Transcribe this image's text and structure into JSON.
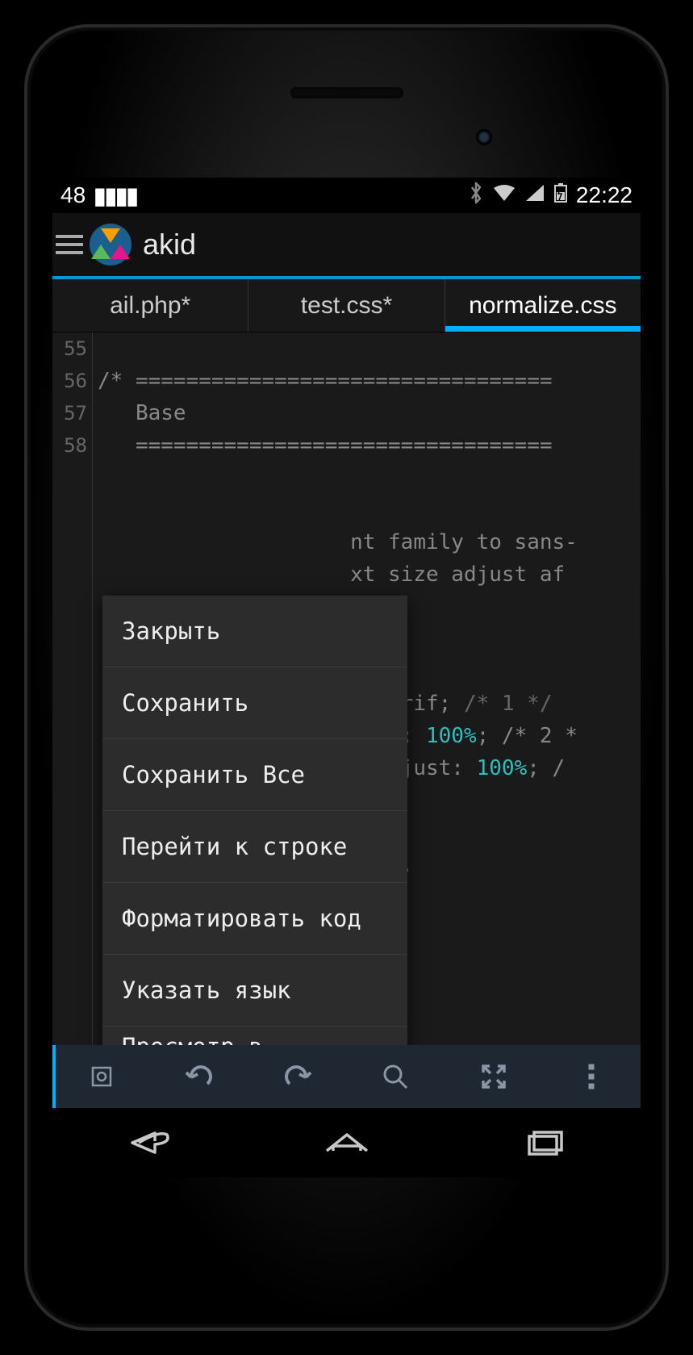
{
  "statusbar": {
    "notification_count": "48",
    "time": "22:22"
  },
  "actionbar": {
    "title": "akid"
  },
  "tabs": [
    {
      "label": "ail.php*",
      "active": false
    },
    {
      "label": "test.css*",
      "active": false
    },
    {
      "label": "normalize.css",
      "active": true
    }
  ],
  "editor": {
    "line_start": 55,
    "gutter_lines": [
      "55",
      "56",
      "57",
      "58"
    ],
    "code_lines": [
      "",
      "/* =================================",
      "   Base",
      "   =================================",
      "",
      "",
      "                    nt family to sans-",
      "                    xt size adjust af",
      "",
      "",
      "",
      "                    s-serif; /* 1 */",
      "                    just: 100%; /* 2 *",
      "                    e-adjust: 100%; /",
      "",
      "",
      "                    rgin.",
      ""
    ]
  },
  "popup": {
    "items": [
      "Закрыть",
      "Сохранить",
      "Сохранить Все",
      "Перейти к строке",
      "Форматировать код",
      "Указать язык",
      "Просмотр в браузере"
    ]
  },
  "toolbar_icons": [
    "settings",
    "undo",
    "redo",
    "search",
    "fullscreen",
    "overflow"
  ],
  "navbar_icons": [
    "back",
    "home",
    "recents"
  ]
}
